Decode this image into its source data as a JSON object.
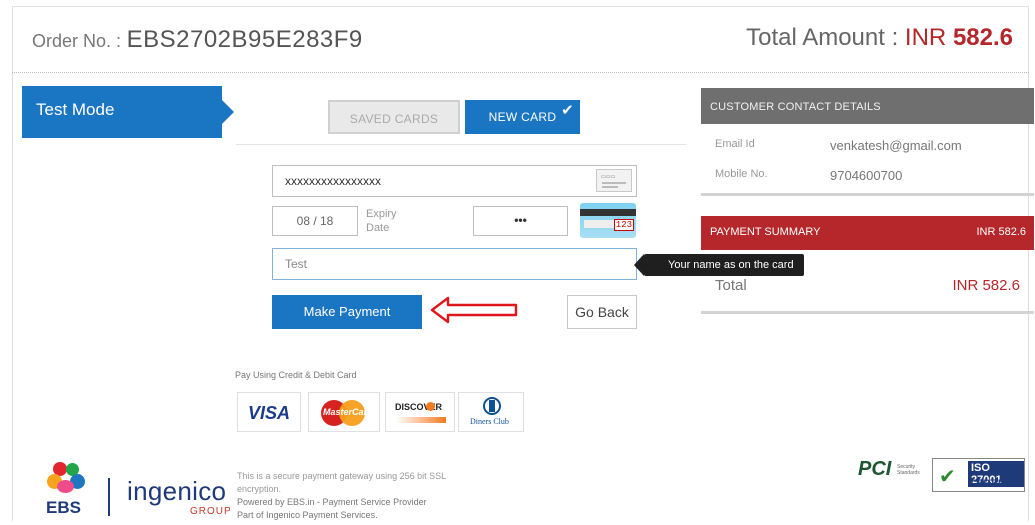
{
  "header": {
    "order_label": "Order No. :",
    "order_number": "EBS2702B95E283F9",
    "total_label": "Total Amount :",
    "total_currency": "INR",
    "total_value": "582.6"
  },
  "mode_banner": "Test Mode",
  "card_tabs": {
    "saved": "SAVED CARDS",
    "new": "NEW CARD",
    "active": "NEW CARD"
  },
  "form": {
    "card_number": "xxxxxxxxxxxxxxxx",
    "card_brand_icon": "credit-card-icon",
    "expiry_value": "08 / 18",
    "expiry_label_line1": "Expiry",
    "expiry_label_line2": "Date",
    "cvv_value": "•••",
    "cvv_code_text": "123",
    "name_value": "Test",
    "name_tooltip": "Your name as on the card",
    "make_payment_label": "Make Payment",
    "go_back_label": "Go Back"
  },
  "payment_methods": {
    "caption": "Pay Using Credit & Debit Card",
    "logos": [
      "VISA",
      "MasterCard",
      "DISCOVER",
      "Diners Club"
    ]
  },
  "footer": {
    "ebs_brand": "EBS",
    "ingenico_brand": "ingenico",
    "ingenico_group": "GROUP",
    "line1": "This is a secure payment gateway using 256 bit SSL",
    "line2": "encryption.",
    "line3": "Powered by EBS.in - Payment Service Provider",
    "line4": "Part of Ingenico Payment Services.",
    "pci": "PCI",
    "pci_sub1": "Security",
    "pci_sub2": "Standards",
    "iso_line1": "ISO 27001",
    "iso_line2": "CERTIFIED"
  },
  "contact": {
    "title": "CUSTOMER CONTACT DETAILS",
    "email_label": "Email Id",
    "email_value": "venkatesh@gmail.com",
    "mobile_label": "Mobile No.",
    "mobile_value": "9704600700"
  },
  "summary": {
    "title": "PAYMENT SUMMARY",
    "header_amount": "INR 582.6",
    "total_label": "Total",
    "total_value": "INR 582.6"
  },
  "colors": {
    "primary_blue": "#1a75c2",
    "brand_red": "#b5272a",
    "panel_gray": "#6f6f6f"
  }
}
